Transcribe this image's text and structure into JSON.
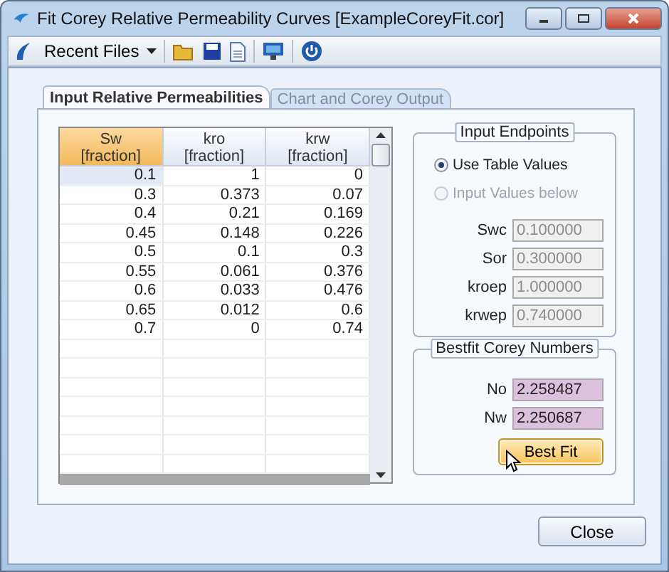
{
  "window": {
    "title": "Fit Corey Relative Permeability Curves [ExampleCoreyFit.cor]"
  },
  "toolbar": {
    "recent_files": "Recent Files"
  },
  "tabs": [
    {
      "label": "Input Relative Permeabilities",
      "selected": true
    },
    {
      "label": "Chart and Corey Output",
      "selected": false
    }
  ],
  "table": {
    "columns": [
      {
        "name": "Sw",
        "unit": "[fraction]",
        "selected": true
      },
      {
        "name": "kro",
        "unit": "[fraction]",
        "selected": false
      },
      {
        "name": "krw",
        "unit": "[fraction]",
        "selected": false
      }
    ],
    "rows": [
      {
        "selected": true,
        "cells": [
          "0.1",
          "1",
          "0"
        ]
      },
      {
        "selected": false,
        "cells": [
          "0.3",
          "0.373",
          "0.07"
        ]
      },
      {
        "selected": false,
        "cells": [
          "0.4",
          "0.21",
          "0.169"
        ]
      },
      {
        "selected": false,
        "cells": [
          "0.45",
          "0.148",
          "0.226"
        ]
      },
      {
        "selected": false,
        "cells": [
          "0.5",
          "0.1",
          "0.3"
        ]
      },
      {
        "selected": false,
        "cells": [
          "0.55",
          "0.061",
          "0.376"
        ]
      },
      {
        "selected": false,
        "cells": [
          "0.6",
          "0.033",
          "0.476"
        ]
      },
      {
        "selected": false,
        "cells": [
          "0.65",
          "0.012",
          "0.6"
        ]
      },
      {
        "selected": false,
        "cells": [
          "0.7",
          "0",
          "0.74"
        ]
      }
    ]
  },
  "endpoints": {
    "title": "Input Endpoints",
    "options": [
      {
        "label": "Use Table Values",
        "selected": true,
        "disabled": false
      },
      {
        "label": "Input Values below",
        "selected": false,
        "disabled": true
      }
    ],
    "fields": [
      {
        "label": "Swc",
        "value": "0.100000",
        "disabled": true
      },
      {
        "label": "Sor",
        "value": "0.300000",
        "disabled": true
      },
      {
        "label": "kroep",
        "value": "1.000000",
        "disabled": true
      },
      {
        "label": "krwep",
        "value": "0.740000",
        "disabled": true
      }
    ]
  },
  "bestfit": {
    "title": "Bestfit Corey Numbers",
    "fields": [
      {
        "label": "No",
        "value": "2.258487"
      },
      {
        "label": "Nw",
        "value": "2.250687"
      }
    ],
    "button": "Best Fit"
  },
  "close_button": "Close"
}
